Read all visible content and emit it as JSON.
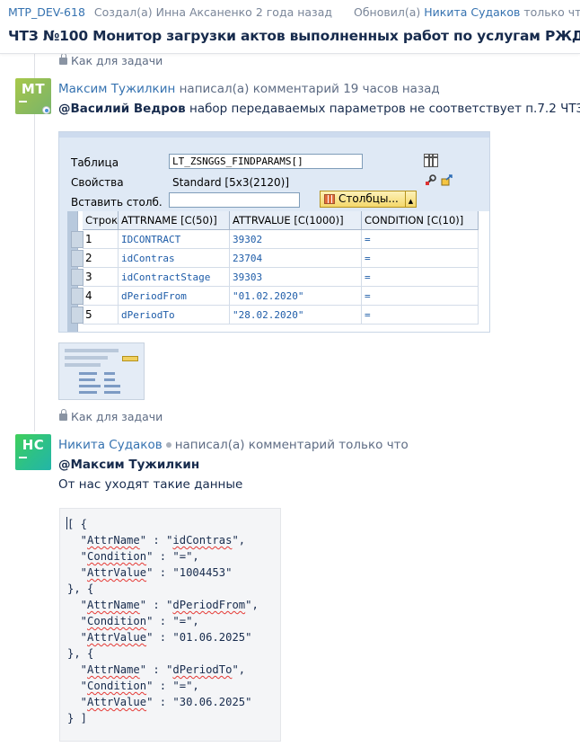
{
  "header": {
    "issue_key": "MTP_DEV-618",
    "created_prefix": "Создал(а)",
    "created_by": "Инна Аксаненко",
    "created_when": "2 года назад",
    "updated_prefix": "Обновил(а)",
    "updated_by": "Никита Судаков",
    "updated_when": "только что",
    "title": "ЧТЗ №100 Монитор загрузки актов выполненных работ по услугам РЖД"
  },
  "restriction_label": "Как для задачи",
  "comments": [
    {
      "avatar_initials": "МТ",
      "author": "Максим Тужилкин",
      "action": "написал(а) комментарий",
      "when": "19 часов назад",
      "mention": "@Василий Ведров",
      "text": " набор передаваемых параметров не соответствует п.7.2 ЧТЗ",
      "attachment": {
        "labels": {
          "table": "Таблица",
          "props": "Свойства",
          "insert": "Вставить столб."
        },
        "table_value": "LT_ZSNGGS_FINDPARAMS[]",
        "props_value": "Standard [5x3(2120)]",
        "insert_value": "",
        "columns_button": "Столбцы...",
        "grid": {
          "headers": [
            "Строка",
            "ATTRNAME [C(50)]",
            "ATTRVALUE [C(1000)]",
            "CONDITION [C(10)]"
          ],
          "rows": [
            [
              "1",
              "IDCONTRACT",
              "39302",
              "="
            ],
            [
              "2",
              "idContras",
              "23704",
              "="
            ],
            [
              "3",
              "idContractStage",
              "39303",
              "="
            ],
            [
              "4",
              "dPeriodFrom",
              "\"01.02.2020\"",
              "="
            ],
            [
              "5",
              "dPeriodTo",
              "\"28.02.2020\"",
              "="
            ]
          ]
        }
      }
    },
    {
      "avatar_initials": "НС",
      "author": "Никита Судаков",
      "action": "написал(а) комментарий",
      "when": "только что",
      "mention": "@Максим Тужилкин",
      "text": "От нас уходят такие данные",
      "code": {
        "entries": [
          {
            "name": "idContras",
            "cond": "=",
            "value": "1004453"
          },
          {
            "name": "dPeriodFrom",
            "cond": "=",
            "value": "01.06.2025"
          },
          {
            "name": "dPeriodTo",
            "cond": "=",
            "value": "30.06.2025"
          }
        ]
      }
    }
  ]
}
